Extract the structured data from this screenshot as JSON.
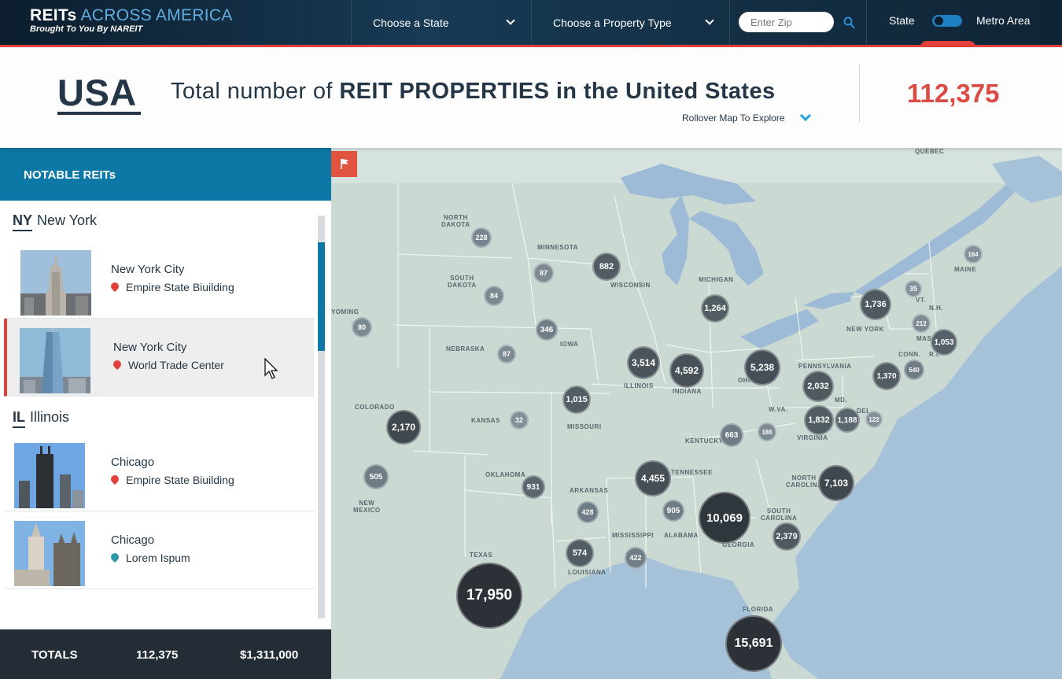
{
  "brand": {
    "name_bold": "REITs",
    "name_light": "ACROSS AMERICA",
    "tagline": "Brought To You By NAREIT"
  },
  "nav": {
    "state_dropdown": "Choose a State",
    "property_dropdown": "Choose a Property Type",
    "zip_placeholder": "Enter Zip",
    "toggle_left": "State",
    "toggle_right": "Metro Area"
  },
  "header": {
    "region": "USA",
    "label_prefix": "Total number of ",
    "label_bold": "REIT PROPERTIES in the United States",
    "hint": "Rollover Map To Explore",
    "total": "112,375"
  },
  "sidebar": {
    "title": "NOTABLE REITs",
    "groups": [
      {
        "abbr": "NY",
        "name": "New York",
        "items": [
          {
            "city": "New York City",
            "building": "Empire State Biuilding",
            "pin": "#e0413a"
          },
          {
            "city": "New York City",
            "building": "World Trade Center",
            "pin": "#e0413a"
          }
        ]
      },
      {
        "abbr": "IL",
        "name": "Illinois",
        "items": [
          {
            "city": "Chicago",
            "building": "Empire State Biuilding",
            "pin": "#e0413a"
          },
          {
            "city": "Chicago",
            "building": "Lorem Ispum",
            "pin": "#2d97ab"
          }
        ]
      }
    ],
    "totals": {
      "label": "TOTALS",
      "count": "112,375",
      "value": "$1,311,000"
    }
  },
  "map": {
    "labels": {
      "nd": "NORTH\nDAKOTA",
      "sd": "SOUTH\nDAKOTA",
      "mn": "MINNESOTA",
      "wi": "WISCONSIN",
      "mi": "MICHIGAN",
      "wy": "YOMING",
      "ne": "NEBRASKA",
      "ia": "IOWA",
      "il": "ILLINOIS",
      "in": "INDIANA",
      "oh": "OHIO",
      "pa": "PENNSYLVANIA",
      "ny": "NEW YORK",
      "vt": "VT.",
      "nh": "N.H.",
      "mass": "MASS.",
      "conn": "CONN.",
      "ri": "R.I.",
      "me": "MAINE",
      "qc": "QUÉBEC",
      "co": "COLORADO",
      "ks": "KANSAS",
      "mo": "MISSOURI",
      "ky": "KENTUCKY",
      "wv": "W.VA.",
      "va": "VIRGINIA",
      "md": "MD.",
      "del": "DEL.",
      "ok": "OKLAHOMA",
      "ar": "ARKANSAS",
      "tn": "TENNESSEE",
      "nc": "NORTH\nCAROLINA",
      "sc": "SOUTH\nCAROLINA",
      "nm": "NEW\nMEXICO",
      "tx": "TEXAS",
      "la": "LOUISIANA",
      "ms": "MISSISSIPPI",
      "al": "ALABAMA",
      "ga": "GEORGIA",
      "fl": "FLORIDA"
    },
    "bubbles": {
      "nd": "228",
      "sd": "84",
      "mn": "87",
      "wi": "882",
      "mi": "1,264",
      "wy": "80",
      "ne": "87",
      "ia": "346",
      "il": "3,514",
      "in": "4,592",
      "oh": "5,238",
      "pa": "2,032",
      "ny": "1,736",
      "vt": "35",
      "nh": "212",
      "mass": "1,053",
      "me": "164",
      "nj": "1,370",
      "ct": "540",
      "co": "2,170",
      "ks": "32",
      "mo": "1,015",
      "ky": "663",
      "wv": "186",
      "va": "1,832",
      "md": "1,188",
      "de": "122",
      "ok": "931",
      "ar": "428",
      "tn": "4,455",
      "nc": "7,103",
      "sc": "2,379",
      "nm": "505",
      "tx": "17,950",
      "la": "574",
      "ms": "422",
      "al": "905",
      "ga": "10,069",
      "fl": "15,691"
    }
  }
}
